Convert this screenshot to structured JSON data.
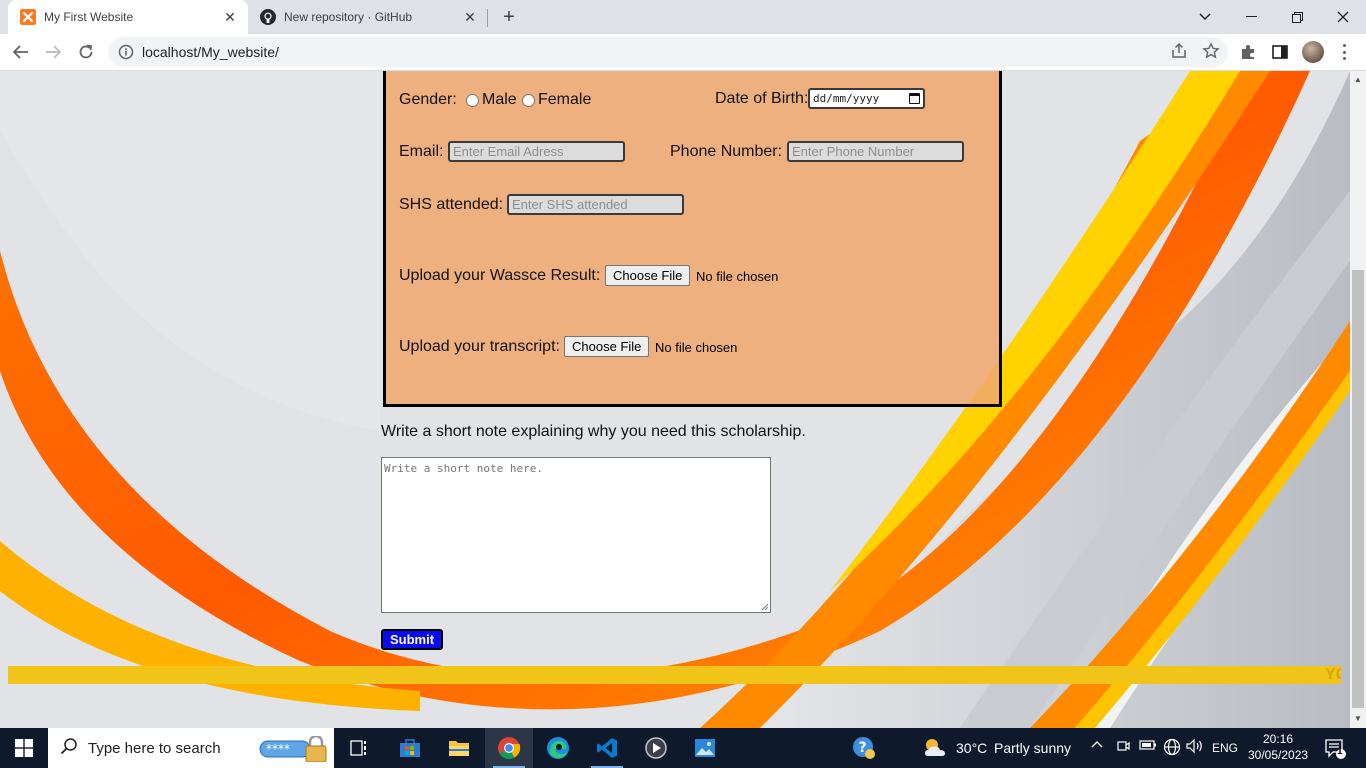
{
  "browser": {
    "tabs": [
      {
        "title": "My First Website",
        "active": true
      },
      {
        "title": "New repository · GitHub",
        "active": false
      }
    ],
    "address": "localhost/My_website/"
  },
  "form": {
    "gender_label": "Gender:",
    "gender_options": [
      "Male",
      "Female"
    ],
    "dob_label": "Date of Birth:",
    "dob_value": "dd/mm/yyyy",
    "email_label": "Email:",
    "email_placeholder": "Enter Email Adress",
    "phone_label": "Phone Number:",
    "phone_placeholder": "Enter Phone Number",
    "shs_label": "SHS attended:",
    "shs_placeholder": "Enter SHS attended",
    "wassce_label": "Upload your Wassce Result:",
    "transcript_label": "Upload your transcript:",
    "choose_file": "Choose File",
    "no_file": "No file chosen",
    "note_label": "Write a short note explaining why you need this scholarship.",
    "note_placeholder": "Write a short note here.",
    "submit": "Submit",
    "ticker": "YO"
  },
  "taskbar": {
    "search_placeholder": "Type here to search",
    "weather_temp": "30°C",
    "weather_desc": "Partly sunny",
    "language": "ENG",
    "time": "20:16",
    "date": "30/05/2023",
    "notification_count": "1"
  },
  "colors": {
    "form_bg": "#f0a86e",
    "submit_bg": "#0a0aee",
    "ticker_bg": "#f0c419",
    "taskbar_bg": "#0e1a2b"
  }
}
